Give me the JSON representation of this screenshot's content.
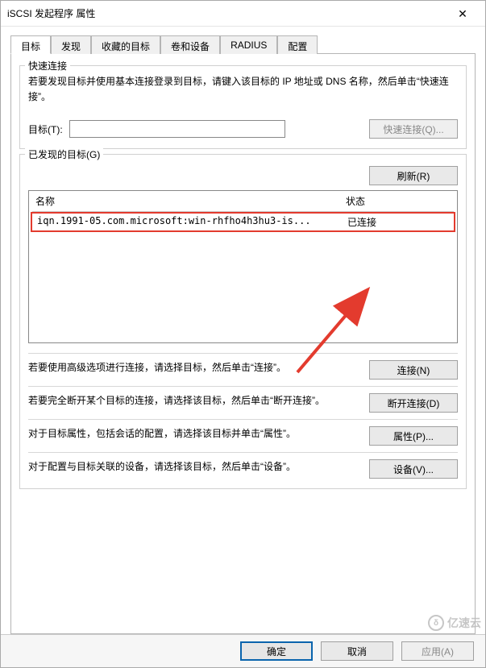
{
  "window": {
    "title": "iSCSI 发起程序 属性"
  },
  "tabs": {
    "items": [
      {
        "label": "目标"
      },
      {
        "label": "发现"
      },
      {
        "label": "收藏的目标"
      },
      {
        "label": "卷和设备"
      },
      {
        "label": "RADIUS"
      },
      {
        "label": "配置"
      }
    ]
  },
  "quick_connect": {
    "group_title": "快速连接",
    "help": "若要发现目标并使用基本连接登录到目标，请键入该目标的 IP 地址或 DNS 名称，然后单击“快速连接”。",
    "target_label": "目标(T):",
    "target_value": "",
    "btn": "快速连接(Q)..."
  },
  "discovered": {
    "group_title": "已发现的目标(G)",
    "refresh_btn": "刷新(R)",
    "col_name": "名称",
    "col_state": "状态",
    "rows": [
      {
        "name": "iqn.1991-05.com.microsoft:win-rhfho4h3hu3-is...",
        "state": "已连接"
      }
    ]
  },
  "actions": {
    "connect_txt": "若要使用高级选项进行连接，请选择目标，然后单击“连接”。",
    "connect_btn": "连接(N)",
    "disconnect_txt": "若要完全断开某个目标的连接，请选择该目标，然后单击“断开连接”。",
    "disconnect_btn": "断开连接(D)",
    "props_txt": "对于目标属性，包括会话的配置，请选择该目标并单击“属性”。",
    "props_btn": "属性(P)...",
    "devices_txt": "对于配置与目标关联的设备，请选择该目标，然后单击“设备”。",
    "devices_btn": "设备(V)..."
  },
  "bottom": {
    "ok": "确定",
    "cancel": "取消",
    "apply": "应用(A)"
  },
  "watermark": "亿速云"
}
